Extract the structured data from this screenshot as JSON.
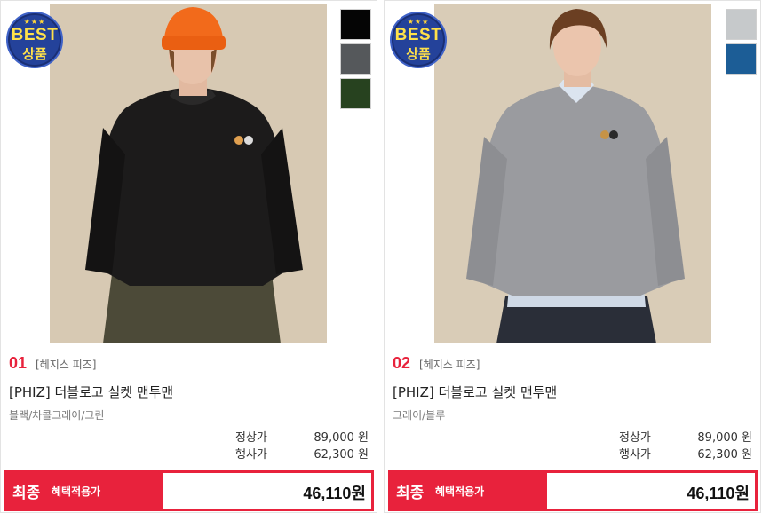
{
  "products": [
    {
      "badge": {
        "stars": "★★★",
        "line1": "BEST",
        "line2": "상품"
      },
      "rank": "01",
      "brand": "[헤지스 피즈]",
      "name": "[PHIZ] 더블로고 실켓 맨투맨",
      "colors": "블랙/차콜그레이/그린",
      "swatches": [
        "#050505",
        "#55585b",
        "#27421f"
      ],
      "regular_label": "정상가",
      "regular_price": "89,000 원",
      "sale_label": "행사가",
      "sale_price": "62,300 원",
      "final_label": "최종",
      "final_sub": "혜택적용가",
      "final_price": "46,110원"
    },
    {
      "badge": {
        "stars": "★★★",
        "line1": "BEST",
        "line2": "상품"
      },
      "rank": "02",
      "brand": "[헤지스 피즈]",
      "name": "[PHIZ] 더블로고 실켓 맨투맨",
      "colors": "그레이/블루",
      "swatches": [
        "#c6c9cb",
        "#1c5d96"
      ],
      "regular_label": "정상가",
      "regular_price": "89,000 원",
      "sale_label": "행사가",
      "sale_price": "62,300 원",
      "final_label": "최종",
      "final_sub": "혜택적용가",
      "final_price": "46,110원"
    }
  ]
}
